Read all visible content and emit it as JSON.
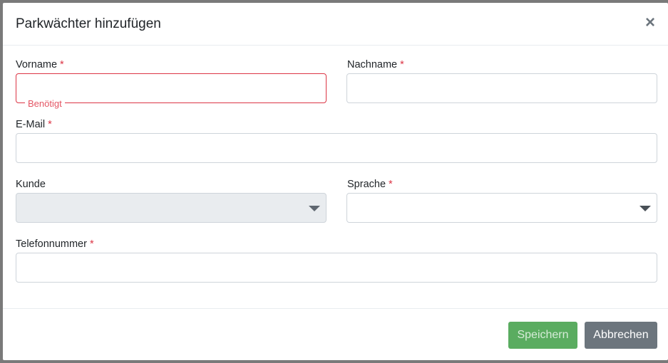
{
  "modal": {
    "title": "Parkwächter hinzufügen",
    "close_symbol": "×"
  },
  "form": {
    "required_marker": "*",
    "vorname": {
      "label": "Vorname",
      "value": "",
      "required": true,
      "error": "Benötigt"
    },
    "nachname": {
      "label": "Nachname",
      "value": "",
      "required": true
    },
    "email": {
      "label": "E-Mail",
      "value": "",
      "required": true
    },
    "kunde": {
      "label": "Kunde",
      "value": "",
      "required": false,
      "disabled": true
    },
    "sprache": {
      "label": "Sprache",
      "value": "",
      "required": true
    },
    "telefon": {
      "label": "Telefonnummer",
      "value": "",
      "required": true
    }
  },
  "footer": {
    "save_label": "Speichern",
    "cancel_label": "Abbrechen"
  },
  "colors": {
    "required": "#dc3545",
    "save_button": "#5aac60",
    "cancel_button": "#6c757d",
    "disabled_input": "#e9ecef"
  },
  "icons": {
    "close": "close-icon",
    "dropdown": "chevron-down-icon"
  }
}
